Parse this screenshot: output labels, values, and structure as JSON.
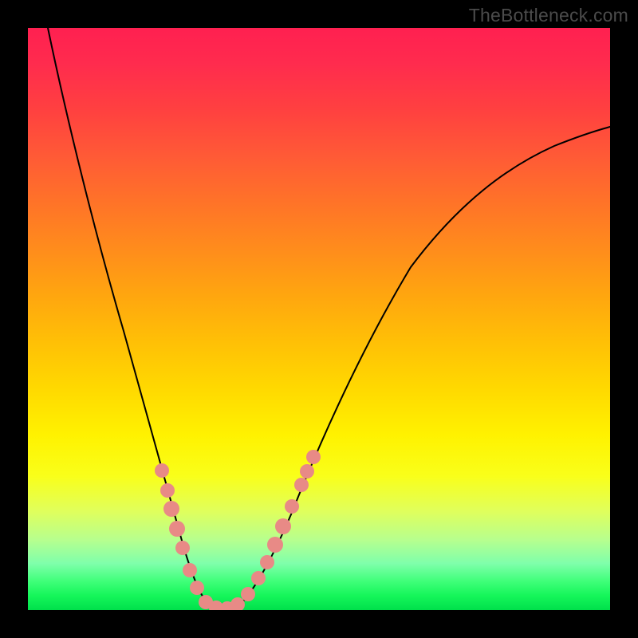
{
  "watermark": "TheBottleneck.com",
  "colors": {
    "frame": "#000000",
    "dot": "#e88a86",
    "curve": "#000000",
    "gradient_top": "#ff2050",
    "gradient_bottom": "#00e04b"
  },
  "chart_data": {
    "type": "line",
    "title": "",
    "xlabel": "",
    "ylabel": "",
    "xlim": [
      0,
      100
    ],
    "ylim": [
      0,
      100
    ],
    "series": [
      {
        "name": "bottleneck-curve",
        "x": [
          0,
          2,
          4,
          6,
          8,
          10,
          12,
          14,
          16,
          18,
          20,
          22,
          24,
          26,
          28,
          30,
          32,
          34,
          36,
          40,
          44,
          48,
          52,
          56,
          60,
          64,
          68,
          72,
          76,
          80,
          84,
          88,
          92,
          96,
          100
        ],
        "y": [
          100,
          92,
          84,
          77,
          70,
          63,
          56,
          50,
          44,
          38,
          32,
          26,
          20,
          14,
          8,
          3,
          0,
          0,
          2,
          7,
          14,
          22,
          30,
          38,
          45,
          52,
          58,
          63,
          68,
          72,
          75,
          78,
          81,
          83,
          85
        ]
      }
    ],
    "highlighted_points_x": [
      20,
      22,
      23,
      25,
      26,
      28,
      29,
      31,
      32,
      33,
      35,
      37,
      38,
      40,
      41,
      43,
      44,
      46
    ]
  }
}
